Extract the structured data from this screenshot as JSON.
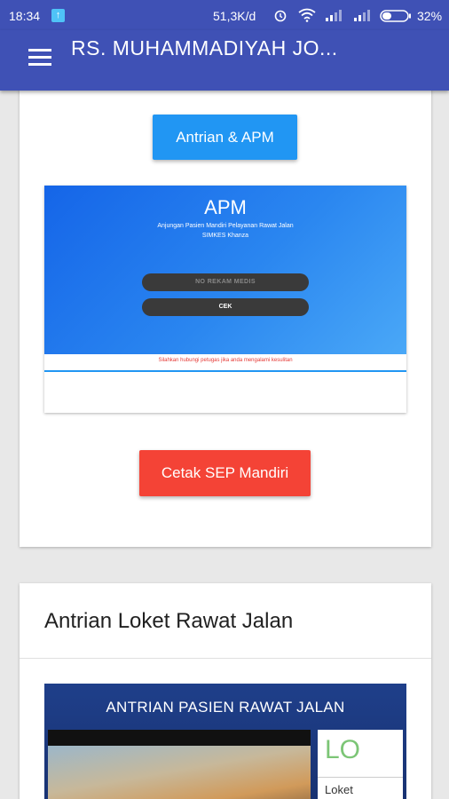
{
  "status_bar": {
    "time": "18:34",
    "upload_icon": "upload-notification-icon",
    "net_speed": "51,3K/d",
    "icons": [
      "alarm-icon",
      "wifi-icon",
      "signal-icon",
      "signal-icon",
      "battery-icon"
    ],
    "battery": "32%"
  },
  "toolbar": {
    "menu_icon": "hamburger-menu-icon",
    "title": "RS. MUHAMMADIYAH JO..."
  },
  "card1": {
    "antrian_button": "Antrian & APM",
    "apm": {
      "title": "APM",
      "subtitle_line1": "Anjungan Pasien Mandiri Pelayanan Rawat Jalan",
      "subtitle_line2": "SIMKES Khanza",
      "input_placeholder": "NO REKAM MEDIS",
      "cek_button": "CEK",
      "help_note": "Silahkan hubungi petugas jika anda mengalami kesulitan"
    },
    "sep_button": "Cetak SEP Mandiri"
  },
  "card2": {
    "title": "Antrian Loket Rawat Jalan",
    "queue": {
      "banner": "ANTRIAN PASIEN RAWAT JALAN",
      "counter_text": "LO",
      "counter_label": "Loket"
    }
  },
  "colors": {
    "app_bar": "#3f51b5",
    "primary_button": "#2196f3",
    "danger_button": "#f44336"
  }
}
